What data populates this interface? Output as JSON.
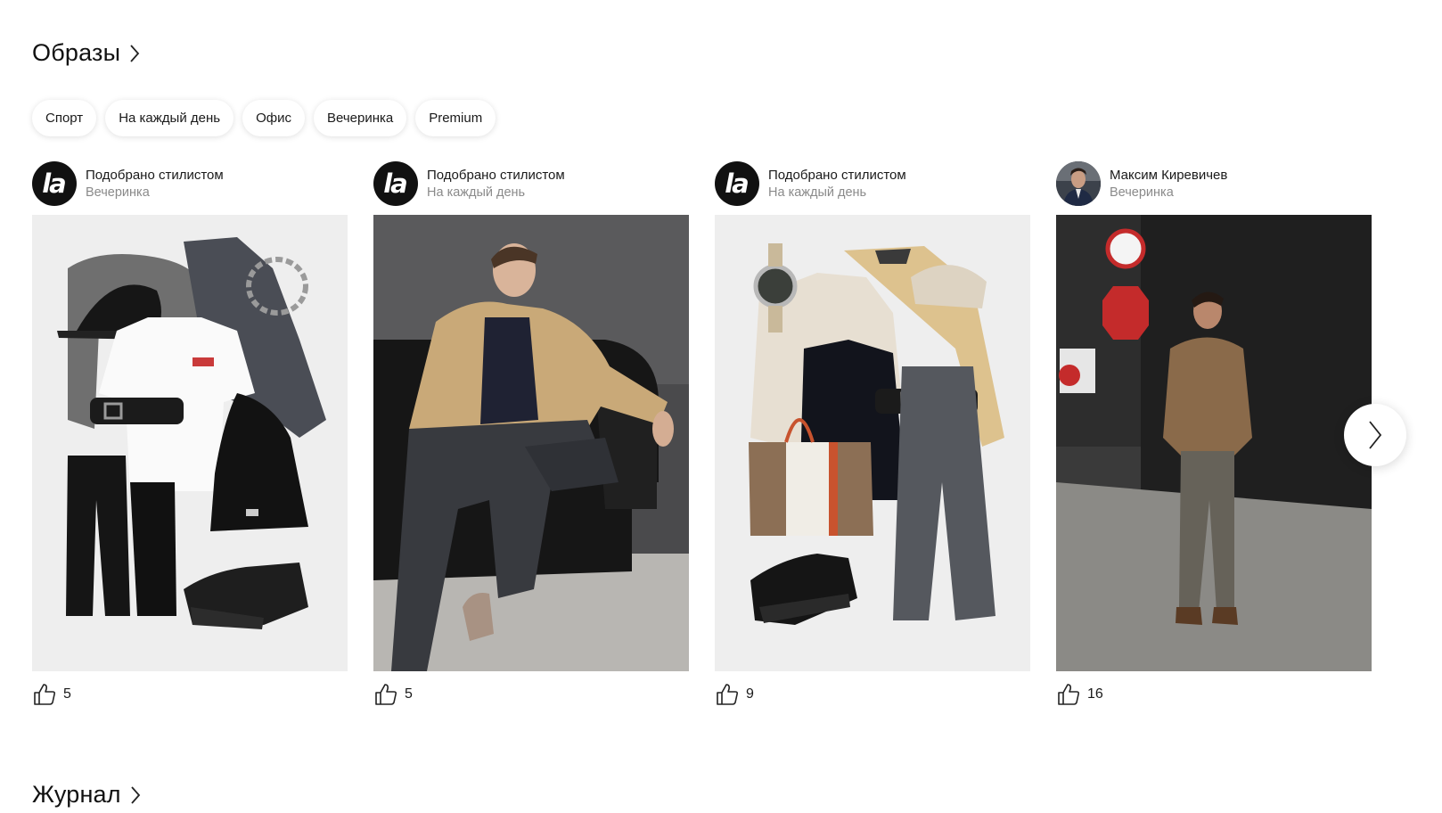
{
  "looks_section": {
    "title": "Образы",
    "filters": [
      "Спорт",
      "На каждый день",
      "Офис",
      "Вечеринка",
      "Premium"
    ],
    "cards": [
      {
        "author": "Подобрано стилистом",
        "category": "Вечеринка",
        "avatar": "brand-logo",
        "avatar_text": "la",
        "likes": "5"
      },
      {
        "author": "Подобрано стилистом",
        "category": "На каждый день",
        "avatar": "brand-logo",
        "avatar_text": "la",
        "likes": "5"
      },
      {
        "author": "Подобрано стилистом",
        "category": "На каждый день",
        "avatar": "brand-logo",
        "avatar_text": "la",
        "likes": "9"
      },
      {
        "author": "Максим Киревичев",
        "category": "Вечеринка",
        "avatar": "user-photo",
        "likes": "16"
      }
    ]
  },
  "journal_section": {
    "title": "Журнал"
  },
  "icons": {
    "section_arrow": "chevron-right-icon",
    "like": "thumbs-up-icon",
    "carousel_next": "chevron-right-icon"
  },
  "colors": {
    "text": "#1a1a1a",
    "muted": "#8a8a8a",
    "avatar_bg": "#111111",
    "chip_bg": "#ffffff"
  }
}
